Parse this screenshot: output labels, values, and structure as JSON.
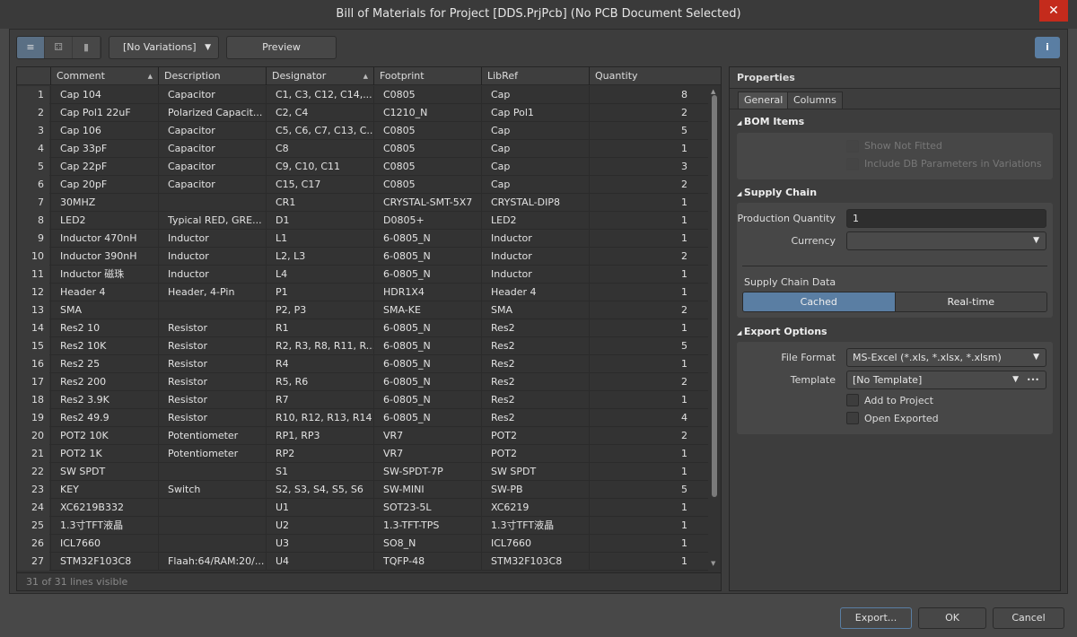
{
  "window": {
    "title": "Bill of Materials for Project [DDS.PrjPcb] (No PCB Document Selected)",
    "close": "✕"
  },
  "toolbar": {
    "views": [
      {
        "icon": "list-view-icon",
        "glyph": "≡"
      },
      {
        "icon": "grouped-view-icon",
        "glyph": "⚃"
      },
      {
        "icon": "chart-view-icon",
        "glyph": "▮"
      }
    ],
    "variations": "[No Variations]",
    "preview": "Preview",
    "info": "i"
  },
  "table": {
    "columns": [
      "Comment",
      "Description",
      "Designator",
      "Footprint",
      "LibRef",
      "Quantity"
    ],
    "sorted_columns": [
      "Comment",
      "Designator"
    ],
    "rows": [
      [
        "1",
        "Cap 104",
        "Capacitor",
        "C1, C3, C12, C14,...",
        "C0805",
        "Cap",
        "8"
      ],
      [
        "2",
        "Cap Pol1 22uF",
        "Polarized Capacit...",
        "C2, C4",
        "C1210_N",
        "Cap Pol1",
        "2"
      ],
      [
        "3",
        "Cap 106",
        "Capacitor",
        "C5, C6, C7, C13, C...",
        "C0805",
        "Cap",
        "5"
      ],
      [
        "4",
        "Cap 33pF",
        "Capacitor",
        "C8",
        "C0805",
        "Cap",
        "1"
      ],
      [
        "5",
        "Cap 22pF",
        "Capacitor",
        "C9, C10, C11",
        "C0805",
        "Cap",
        "3"
      ],
      [
        "6",
        "Cap 20pF",
        "Capacitor",
        "C15, C17",
        "C0805",
        "Cap",
        "2"
      ],
      [
        "7",
        "30MHZ",
        "",
        "CR1",
        "CRYSTAL-SMT-5X7",
        "CRYSTAL-DIP8",
        "1"
      ],
      [
        "8",
        "LED2",
        "Typical RED, GRE...",
        "D1",
        "D0805+",
        "LED2",
        "1"
      ],
      [
        "9",
        "Inductor 470nH",
        "Inductor",
        "L1",
        "6-0805_N",
        "Inductor",
        "1"
      ],
      [
        "10",
        "Inductor 390nH",
        "Inductor",
        "L2, L3",
        "6-0805_N",
        "Inductor",
        "2"
      ],
      [
        "11",
        "Inductor 磁珠",
        "Inductor",
        "L4",
        "6-0805_N",
        "Inductor",
        "1"
      ],
      [
        "12",
        "Header 4",
        "Header, 4-Pin",
        "P1",
        "HDR1X4",
        "Header 4",
        "1"
      ],
      [
        "13",
        "SMA",
        "",
        "P2, P3",
        "SMA-KE",
        "SMA",
        "2"
      ],
      [
        "14",
        "Res2 10",
        "Resistor",
        "R1",
        "6-0805_N",
        "Res2",
        "1"
      ],
      [
        "15",
        "Res2 10K",
        "Resistor",
        "R2, R3, R8, R11, R...",
        "6-0805_N",
        "Res2",
        "5"
      ],
      [
        "16",
        "Res2 25",
        "Resistor",
        "R4",
        "6-0805_N",
        "Res2",
        "1"
      ],
      [
        "17",
        "Res2 200",
        "Resistor",
        "R5, R6",
        "6-0805_N",
        "Res2",
        "2"
      ],
      [
        "18",
        "Res2 3.9K",
        "Resistor",
        "R7",
        "6-0805_N",
        "Res2",
        "1"
      ],
      [
        "19",
        "Res2 49.9",
        "Resistor",
        "R10, R12, R13, R14",
        "6-0805_N",
        "Res2",
        "4"
      ],
      [
        "20",
        "POT2 10K",
        "Potentiometer",
        "RP1, RP3",
        "VR7",
        "POT2",
        "2"
      ],
      [
        "21",
        "POT2 1K",
        "Potentiometer",
        "RP2",
        "VR7",
        "POT2",
        "1"
      ],
      [
        "22",
        "SW SPDT",
        "",
        "S1",
        "SW-SPDT-7P",
        "SW SPDT",
        "1"
      ],
      [
        "23",
        "KEY",
        "Switch",
        "S2, S3, S4, S5, S6",
        "SW-MINI",
        "SW-PB",
        "5"
      ],
      [
        "24",
        "XC6219B332",
        "",
        "U1",
        "SOT23-5L",
        "XC6219",
        "1"
      ],
      [
        "25",
        "1.3寸TFT液晶",
        "",
        "U2",
        "1.3-TFT-TPS",
        "1.3寸TFT液晶",
        "1"
      ],
      [
        "26",
        "ICL7660",
        "",
        "U3",
        "SO8_N",
        "ICL7660",
        "1"
      ],
      [
        "27",
        "STM32F103C8",
        "Flaah:64/RAM:20/...",
        "U4",
        "TQFP-48",
        "STM32F103C8",
        "1"
      ]
    ],
    "status": "31 of 31 lines visible"
  },
  "properties": {
    "title": "Properties",
    "tabs": [
      "General",
      "Columns"
    ],
    "active_tab": "General",
    "bom_items": {
      "title": "BOM Items",
      "show_not_fitted": "Show Not Fitted",
      "include_db": "Include DB Parameters in Variations"
    },
    "supply_chain": {
      "title": "Supply Chain",
      "production_quantity_label": "Production Quantity",
      "production_quantity": "1",
      "currency_label": "Currency",
      "currency": "",
      "data_label": "Supply Chain Data",
      "cached": "Cached",
      "realtime": "Real-time",
      "selected": "Cached"
    },
    "export": {
      "title": "Export Options",
      "file_format_label": "File Format",
      "file_format": "MS-Excel (*.xls, *.xlsx, *.xlsm)",
      "template_label": "Template",
      "template": "[No Template]",
      "more": "•••",
      "add_to_project": "Add to Project",
      "open_exported": "Open Exported"
    }
  },
  "buttons": {
    "export": "Export...",
    "ok": "OK",
    "cancel": "Cancel"
  },
  "colors": {
    "accent": "#5a7ea3",
    "selected_segment": "#5a6f84",
    "close": "#c42b1c"
  }
}
